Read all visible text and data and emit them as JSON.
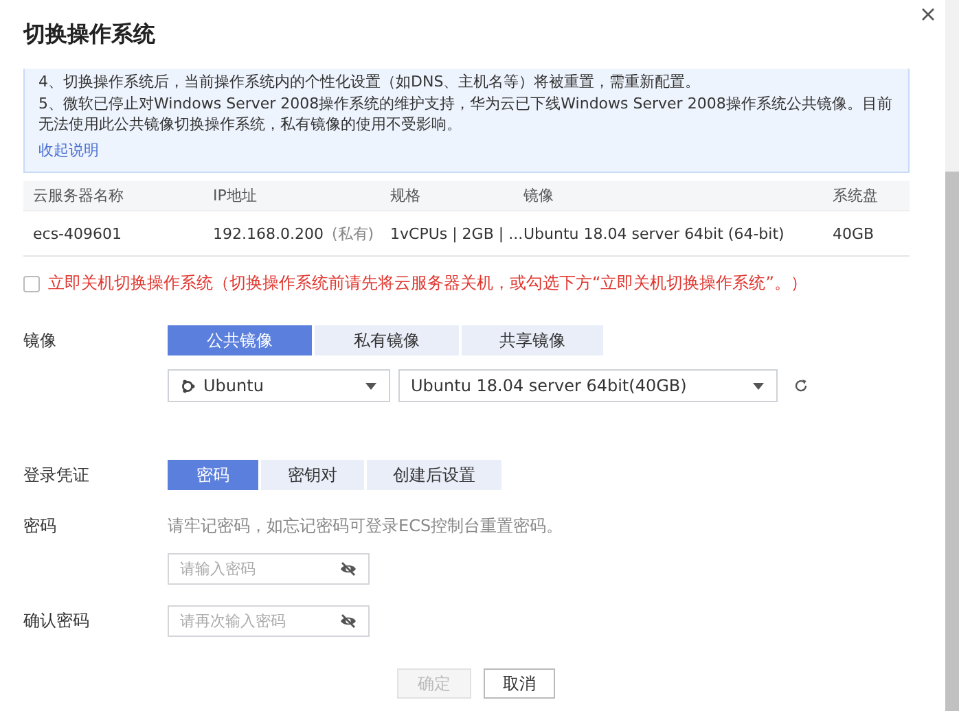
{
  "dialog": {
    "title": "切换操作系统"
  },
  "notice": {
    "lines": [
      "4、切换操作系统后，当前操作系统内的个性化设置（如DNS、主机名等）将被重置，需重新配置。",
      "5、微软已停止对Windows Server 2008操作系统的维护支持，华为云已下线Windows Server 2008操作系统公共镜像。目前无法使用此公共镜像切换操作系统，私有镜像的使用不受影响。"
    ],
    "collapse_link": "收起说明"
  },
  "table": {
    "columns": [
      "云服务器名称",
      "IP地址",
      "规格",
      "镜像",
      "系统盘"
    ],
    "rows": [
      {
        "cells": [
          "ecs-409601",
          "192.168.0.200",
          "1vCPUs | 2GB | ...",
          "Ubuntu 18.04 server 64bit (64-bit)",
          "40GB"
        ],
        "ip_note": "(私有)"
      }
    ]
  },
  "shutdown": {
    "checked": false,
    "label": "立即关机切换操作系统（切换操作系统前请先将云服务器关机，或勾选下方“立即关机切换操作系统”。）"
  },
  "image": {
    "label": "镜像",
    "tabs": [
      {
        "label": "公共镜像",
        "selected": true
      },
      {
        "label": "私有镜像",
        "selected": false
      },
      {
        "label": "共享镜像",
        "selected": false
      }
    ],
    "os": "Ubuntu",
    "version": "Ubuntu 18.04 server 64bit(40GB)"
  },
  "login": {
    "label": "登录凭证",
    "tabs": [
      {
        "label": "密码",
        "selected": true
      },
      {
        "label": "密钥对",
        "selected": false
      },
      {
        "label": "创建后设置",
        "selected": false
      }
    ]
  },
  "password": {
    "label": "密码",
    "hint": "请牢记密码，如忘记密码可登录ECS控制台重置密码。",
    "placeholder": "请输入密码"
  },
  "confirm": {
    "label": "确认密码",
    "placeholder": "请再次输入密码"
  },
  "buttons": [
    {
      "label": "确定",
      "disabled": true
    },
    {
      "label": "取消",
      "disabled": false
    }
  ]
}
